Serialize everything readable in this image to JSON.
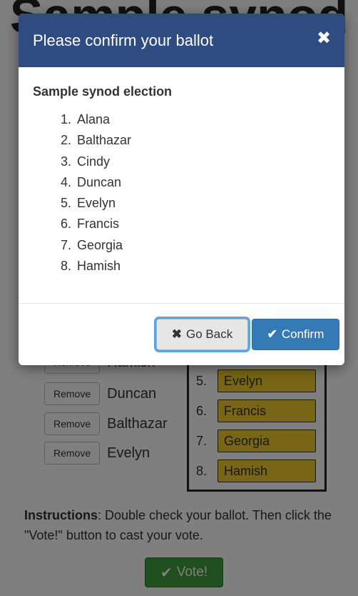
{
  "page": {
    "title": "Sample synod",
    "removed": [
      {
        "button": "Remove",
        "name": "Hamish"
      },
      {
        "button": "Remove",
        "name": "Duncan"
      },
      {
        "button": "Remove",
        "name": "Balthazar"
      },
      {
        "button": "Remove",
        "name": "Evelyn"
      }
    ],
    "ranked": [
      {
        "num": "5.",
        "name": "Evelyn"
      },
      {
        "num": "6.",
        "name": "Francis"
      },
      {
        "num": "7.",
        "name": "Georgia"
      },
      {
        "num": "8.",
        "name": "Hamish"
      }
    ],
    "instructions_label": "Instructions",
    "instructions_text": ": Double check your ballot. Then click the \"Vote!\" button to cast your vote.",
    "vote_button": "Vote!",
    "ranked_color": "#f0ca2c",
    "vote_color": "#3e9e3e"
  },
  "modal": {
    "title": "Please confirm your ballot",
    "close_icon": "close-icon",
    "election_name": "Sample synod election",
    "ballot": [
      {
        "num": "1.",
        "name": "Alana"
      },
      {
        "num": "2.",
        "name": "Balthazar"
      },
      {
        "num": "3.",
        "name": "Cindy"
      },
      {
        "num": "4.",
        "name": "Duncan"
      },
      {
        "num": "5.",
        "name": "Evelyn"
      },
      {
        "num": "6.",
        "name": "Francis"
      },
      {
        "num": "7.",
        "name": "Georgia"
      },
      {
        "num": "8.",
        "name": "Hamish"
      }
    ],
    "back_button": "Go Back",
    "confirm_button": "Confirm",
    "header_color": "#2f4b7f",
    "confirm_color": "#337ab7"
  }
}
